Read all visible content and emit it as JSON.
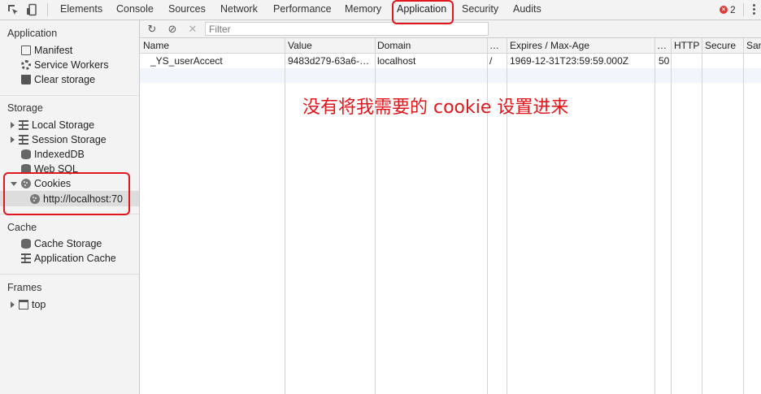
{
  "toolbar": {
    "tabs": [
      "Elements",
      "Console",
      "Sources",
      "Network",
      "Performance",
      "Memory",
      "Application",
      "Security",
      "Audits"
    ],
    "active_tab": "Application",
    "error_count": "2"
  },
  "sidebar": {
    "application": {
      "title": "Application",
      "items": [
        "Manifest",
        "Service Workers",
        "Clear storage"
      ]
    },
    "storage": {
      "title": "Storage",
      "items": [
        "Local Storage",
        "Session Storage",
        "IndexedDB",
        "Web SQL",
        "Cookies"
      ],
      "cookie_child": "http://localhost:70"
    },
    "cache": {
      "title": "Cache",
      "items": [
        "Cache Storage",
        "Application Cache"
      ]
    },
    "frames": {
      "title": "Frames",
      "items": [
        "top"
      ]
    }
  },
  "main": {
    "filter_placeholder": "Filter",
    "columns": [
      "Name",
      "Value",
      "Domain",
      "…",
      "Expires / Max-Age",
      "…",
      "HTTP",
      "Secure",
      "Sam"
    ],
    "rows": [
      [
        "_YS_userAccect",
        "9483d279-63a6-…",
        "localhost",
        "/",
        "1969-12-31T23:59:59.000Z",
        "50",
        "",
        "",
        ""
      ]
    ],
    "annotation": "没有将我需要的 cookie 设置进来"
  },
  "colors": {
    "highlight": "#e0171c",
    "selected_bg": "#dddddd",
    "stripe": "#f1f6fd"
  }
}
